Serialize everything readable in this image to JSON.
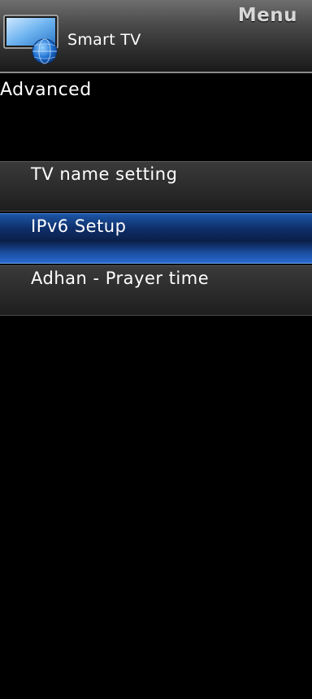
{
  "header": {
    "menu_label": "Menu",
    "app_icon": "smart-tv-globe-icon",
    "app_title": "Smart TV"
  },
  "section": {
    "title": "Advanced"
  },
  "menu": {
    "items": [
      {
        "label": "TV name setting",
        "selected": false
      },
      {
        "label": "IPv6 Setup",
        "selected": true
      },
      {
        "label": "Adhan - Prayer time",
        "selected": false
      }
    ]
  },
  "colors": {
    "selected_accent": "#1c55a6",
    "background": "#000000",
    "item_background": "#2c2c2c"
  }
}
